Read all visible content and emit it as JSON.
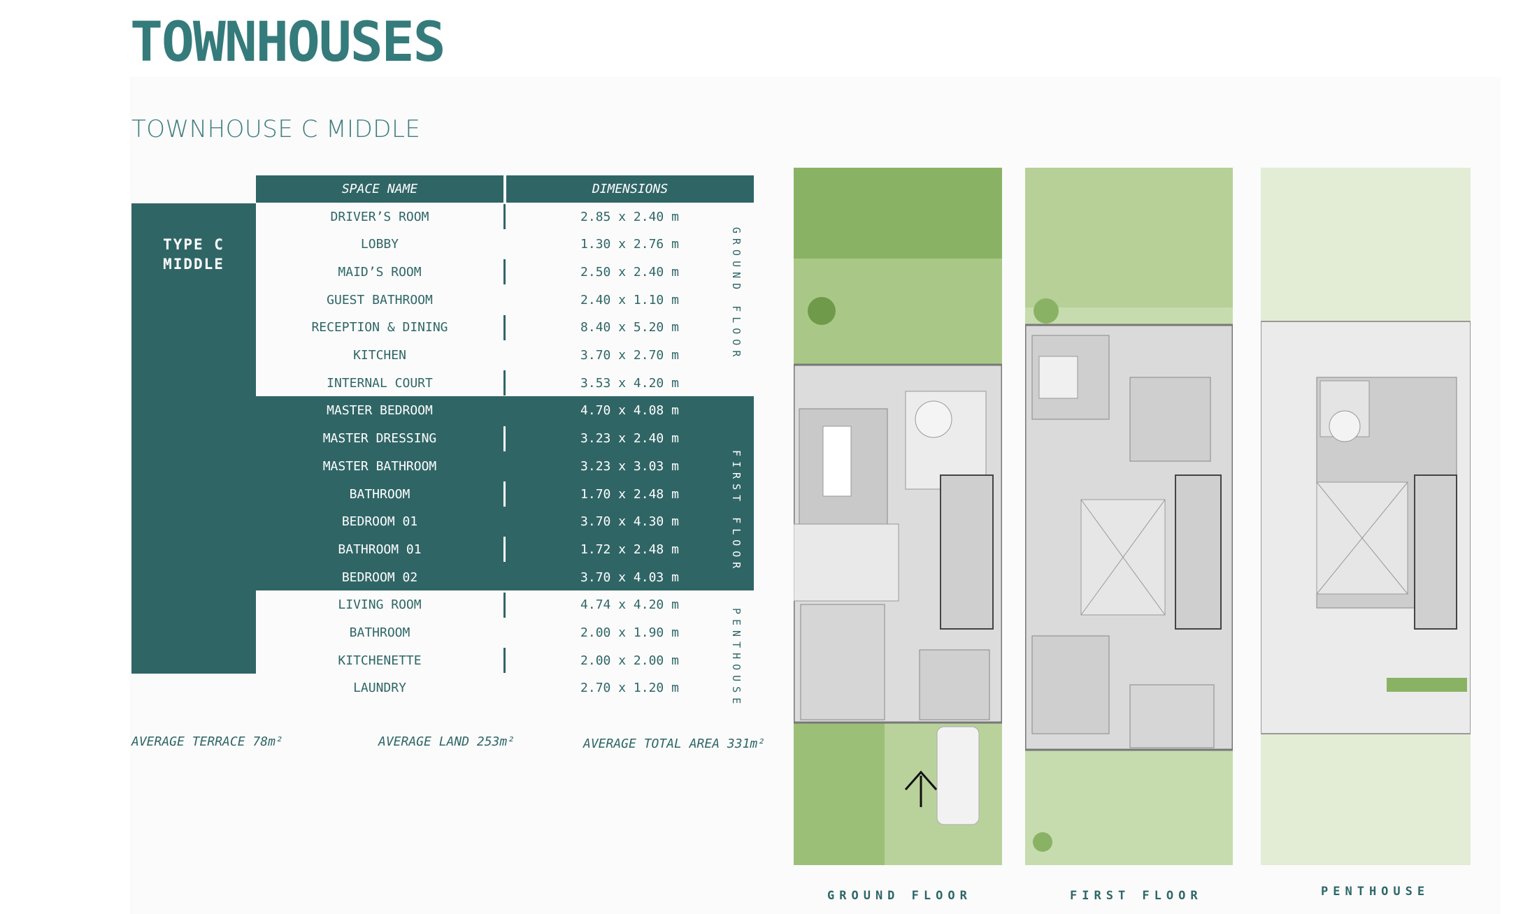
{
  "page": {
    "title": "TOWNHOUSES",
    "subtitle": "TOWNHOUSE C MIDDLE"
  },
  "table": {
    "type_label_line1": "TYPE C",
    "type_label_line2": "MIDDLE",
    "col_space": "SPACE NAME",
    "col_dimensions": "DIMENSIONS",
    "floor_ground": "GROUND FLOOR",
    "floor_first": "FIRST FLOOR",
    "floor_penthouse": "PENTHOUSE",
    "rows": [
      {
        "name": "DRIVER’S ROOM",
        "dim": "2.85 x 2.40 m"
      },
      {
        "name": "LOBBY",
        "dim": "1.30 x 2.76 m"
      },
      {
        "name": "MAID’S ROOM",
        "dim": "2.50 x 2.40 m"
      },
      {
        "name": "GUEST BATHROOM",
        "dim": "2.40 x 1.10 m"
      },
      {
        "name": "RECEPTION & DINING",
        "dim": "8.40 x 5.20 m"
      },
      {
        "name": "KITCHEN",
        "dim": "3.70 x 2.70 m"
      },
      {
        "name": "INTERNAL COURT",
        "dim": "3.53 x 4.20 m"
      },
      {
        "name": "MASTER BEDROOM",
        "dim": "4.70 x 4.08 m"
      },
      {
        "name": "MASTER DRESSING",
        "dim": "3.23 x 2.40 m"
      },
      {
        "name": "MASTER BATHROOM",
        "dim": "3.23 x 3.03 m"
      },
      {
        "name": "BATHROOM",
        "dim": "1.70 x 2.48 m"
      },
      {
        "name": "BEDROOM 01",
        "dim": "3.70 x 4.30 m"
      },
      {
        "name": "BATHROOM 01",
        "dim": "1.72 x 2.48 m"
      },
      {
        "name": "BEDROOM 02",
        "dim": "3.70 x 4.03 m"
      },
      {
        "name": "LIVING ROOM",
        "dim": "4.74 x 4.20 m"
      },
      {
        "name": "BATHROOM",
        "dim": "2.00 x 1.90 m"
      },
      {
        "name": "KITCHENETTE",
        "dim": "2.00 x 2.00 m"
      },
      {
        "name": "LAUNDRY",
        "dim": "2.70 x 1.20 m"
      }
    ]
  },
  "summary": {
    "terrace": "AVERAGE TERRACE 78m²",
    "land": "AVERAGE LAND 253m²",
    "total": "AVERAGE TOTAL AREA 331m²"
  },
  "plans": {
    "ground_label": "GROUND FLOOR",
    "first_label": "FIRST FLOOR",
    "penthouse_label": "PENTHOUSE"
  },
  "colors": {
    "accent": "#306566",
    "title": "#357b7b",
    "grass": "#8fb56a"
  }
}
